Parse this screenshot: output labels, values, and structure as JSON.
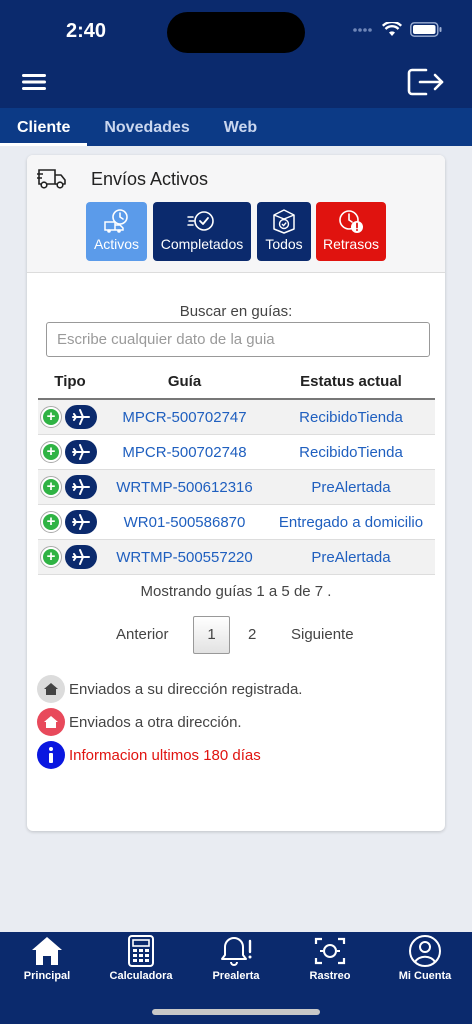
{
  "status_bar": {
    "time": "2:40"
  },
  "tabs": [
    {
      "label": "Cliente",
      "active": true
    },
    {
      "label": "Novedades",
      "active": false
    },
    {
      "label": "Web",
      "active": false
    }
  ],
  "card": {
    "title": "Envíos Activos",
    "filters": [
      {
        "label": "Activos",
        "color": "#5b9bea",
        "icon": "clock-truck-icon"
      },
      {
        "label": "Completados",
        "color": "#0b2a6d",
        "icon": "check-fast-icon"
      },
      {
        "label": "Todos",
        "color": "#0b2a6d",
        "icon": "box-check-icon"
      },
      {
        "label": "Retrasos",
        "color": "#e0130f",
        "icon": "late-clock-icon"
      }
    ],
    "search": {
      "label": "Buscar en guías:",
      "placeholder": "Escribe cualquier dato de la guia",
      "value": ""
    },
    "table": {
      "headers": [
        "Tipo",
        "Guía",
        "Estatus actual"
      ],
      "rows": [
        {
          "guia": "MPCR-500702747",
          "status": "RecibidoTienda"
        },
        {
          "guia": "MPCR-500702748",
          "status": "RecibidoTienda"
        },
        {
          "guia": "WRTMP-500612316",
          "status": "PreAlertada"
        },
        {
          "guia": "WR01-500586870",
          "status": "Entregado a domicilio"
        },
        {
          "guia": "WRTMP-500557220",
          "status": "PreAlertada"
        }
      ]
    },
    "showing_text": "Mostrando guías 1 a 5 de 7 .",
    "pagination": {
      "prev": "Anterior",
      "page1": "1",
      "page2": "2",
      "next": "Siguiente"
    },
    "legend": [
      {
        "text": "Enviados a su dirección registrada.",
        "color": "#444444"
      },
      {
        "text": "Enviados a otra dirección.",
        "color": "#444444"
      },
      {
        "text": "Informacion ultimos 180 días",
        "color": "#e0130f"
      }
    ]
  },
  "bottom_nav": [
    {
      "label": "Principal",
      "icon": "home-icon"
    },
    {
      "label": "Calculadora",
      "icon": "calculator-icon"
    },
    {
      "label": "Prealerta",
      "icon": "bell-alert-icon"
    },
    {
      "label": "Rastreo",
      "icon": "scan-icon"
    },
    {
      "label": "Mi Cuenta",
      "icon": "user-icon"
    }
  ],
  "colors": {
    "primary": "#0b2a6d",
    "tabbar": "#0c3a86",
    "link": "#1f5fbf",
    "danger": "#e0130f",
    "success": "#2fb344"
  }
}
